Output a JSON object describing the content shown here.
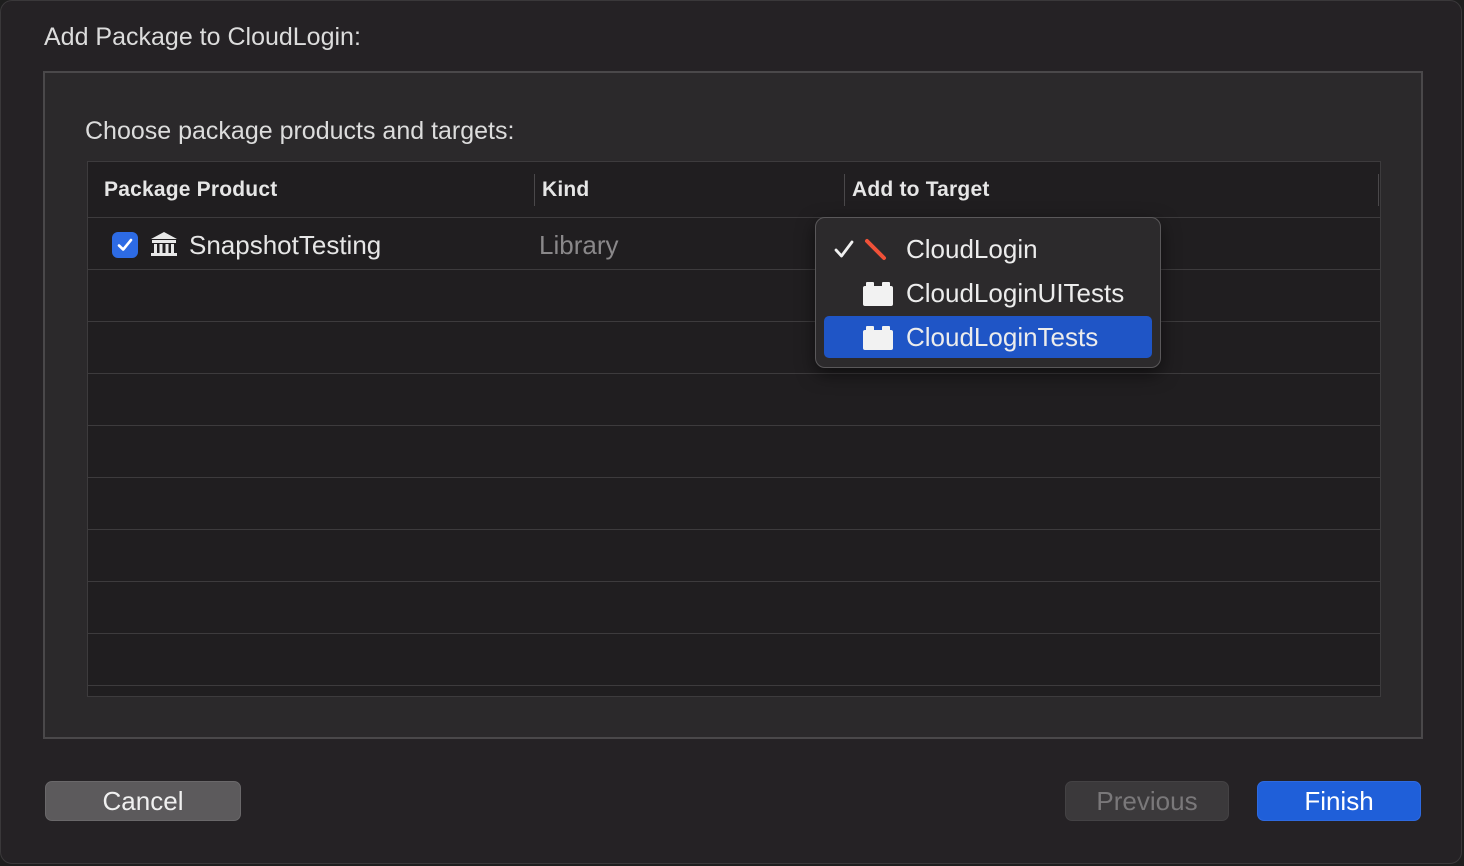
{
  "dialog": {
    "title": "Add Package to CloudLogin:",
    "heading": "Choose package products and targets:"
  },
  "table": {
    "columns": [
      "Package Product",
      "Kind",
      "Add to Target"
    ],
    "rows": [
      {
        "checked": true,
        "icon": "library-icon",
        "product": "SnapshotTesting",
        "kind": "Library"
      }
    ]
  },
  "target_menu": {
    "items": [
      {
        "label": "CloudLogin",
        "icon": "swift-app-icon",
        "checked": true,
        "highlighted": false
      },
      {
        "label": "CloudLoginUITests",
        "icon": "test-bundle-icon",
        "checked": false,
        "highlighted": false
      },
      {
        "label": "CloudLoginTests",
        "icon": "test-bundle-icon",
        "checked": false,
        "highlighted": true
      }
    ]
  },
  "buttons": {
    "cancel": "Cancel",
    "previous": "Previous",
    "finish": "Finish"
  },
  "colors": {
    "accent": "#1f5fd9",
    "swift_orange": "#f05138"
  }
}
